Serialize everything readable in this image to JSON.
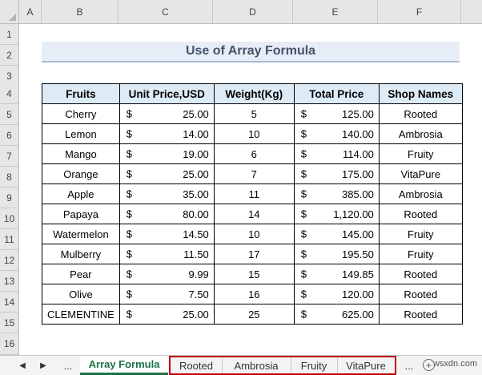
{
  "columns": [
    "A",
    "B",
    "C",
    "D",
    "E",
    "F"
  ],
  "rows": [
    "1",
    "2",
    "3",
    "4",
    "5",
    "6",
    "7",
    "8",
    "9",
    "10",
    "11",
    "12",
    "13",
    "14",
    "15",
    "16"
  ],
  "sheet_title": "Use of Array Formula",
  "table": {
    "headers": [
      "Fruits",
      "Unit Price,USD",
      "Weight(Kg)",
      "Total Price",
      "Shop Names"
    ],
    "currency_symbol": "$",
    "rows": [
      {
        "fruit": "Cherry",
        "unit_price": "25.00",
        "weight": "5",
        "total": "125.00",
        "shop": "Rooted"
      },
      {
        "fruit": "Lemon",
        "unit_price": "14.00",
        "weight": "10",
        "total": "140.00",
        "shop": "Ambrosia"
      },
      {
        "fruit": "Mango",
        "unit_price": "19.00",
        "weight": "6",
        "total": "114.00",
        "shop": "Fruity"
      },
      {
        "fruit": "Orange",
        "unit_price": "25.00",
        "weight": "7",
        "total": "175.00",
        "shop": "VitaPure"
      },
      {
        "fruit": "Apple",
        "unit_price": "35.00",
        "weight": "11",
        "total": "385.00",
        "shop": "Ambrosia"
      },
      {
        "fruit": "Papaya",
        "unit_price": "80.00",
        "weight": "14",
        "total": "1,120.00",
        "shop": "Rooted"
      },
      {
        "fruit": "Watermelon",
        "unit_price": "14.50",
        "weight": "10",
        "total": "145.00",
        "shop": "Fruity"
      },
      {
        "fruit": "Mulberry",
        "unit_price": "11.50",
        "weight": "17",
        "total": "195.50",
        "shop": "Fruity"
      },
      {
        "fruit": "Pear",
        "unit_price": "9.99",
        "weight": "15",
        "total": "149.85",
        "shop": "Rooted"
      },
      {
        "fruit": "Olive",
        "unit_price": "7.50",
        "weight": "16",
        "total": "120.00",
        "shop": "Rooted"
      },
      {
        "fruit": "CLEMENTINE",
        "unit_price": "25.00",
        "weight": "25",
        "total": "625.00",
        "shop": "Rooted"
      }
    ]
  },
  "tabbar": {
    "nav_prev": "◀",
    "nav_next": "▶",
    "ellipsis_left": "...",
    "ellipsis_right": "...",
    "add_sheet": "+",
    "active_tab": "Array Formula",
    "tabs": [
      "Rooted",
      "Ambrosia",
      "Fruity",
      "VitaPure"
    ],
    "highlight_color": "#c00000",
    "active_color": "#1e7145"
  },
  "watermark": "wsxdn.com"
}
